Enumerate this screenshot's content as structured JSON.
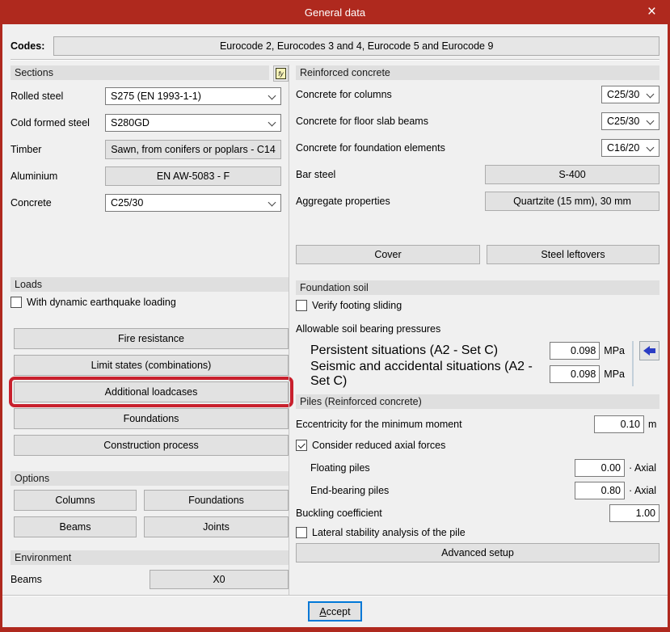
{
  "window": {
    "title": "General data",
    "close_glyph": "×"
  },
  "codes": {
    "label": "Codes:",
    "value": "Eurocode 2, Eurocodes 3 and 4, Eurocode 5 and Eurocode 9"
  },
  "left": {
    "sections": {
      "header": "Sections",
      "fy_icon": "fy",
      "rolled_steel": {
        "label": "Rolled steel",
        "value": "S275 (EN 1993-1-1)"
      },
      "cold_formed_steel": {
        "label": "Cold formed steel",
        "value": "S280GD"
      },
      "timber": {
        "label": "Timber",
        "value": "Sawn, from conifers or poplars - C14"
      },
      "aluminium": {
        "label": "Aluminium",
        "value": "EN AW-5083 - F"
      },
      "concrete": {
        "label": "Concrete",
        "value": "C25/30"
      }
    },
    "loads": {
      "header": "Loads",
      "dynamic_earthquake": {
        "label": "With dynamic earthquake loading",
        "checked": false
      },
      "fire_resistance": "Fire resistance",
      "limit_states": "Limit states (combinations)",
      "additional_loadcases": "Additional loadcases",
      "foundations": "Foundations",
      "construction_process": "Construction process",
      "highlighted_button": "Additional loadcases"
    },
    "options": {
      "header": "Options",
      "columns": "Columns",
      "foundations": "Foundations",
      "beams": "Beams",
      "joints": "Joints"
    },
    "environment": {
      "header": "Environment",
      "beams": {
        "label": "Beams",
        "value": "X0"
      }
    }
  },
  "right": {
    "reinforced_concrete": {
      "header": "Reinforced concrete",
      "concrete_columns": {
        "label": "Concrete for columns",
        "value": "C25/30"
      },
      "concrete_floor_slab_beams": {
        "label": "Concrete for floor slab beams",
        "value": "C25/30"
      },
      "concrete_foundation_elements": {
        "label": "Concrete for foundation elements",
        "value": "C16/20"
      },
      "bar_steel": {
        "label": "Bar steel",
        "value": "S-400"
      },
      "aggregate": {
        "label": "Aggregate properties",
        "value": "Quartzite (15 mm), 30 mm"
      },
      "cover_button": "Cover",
      "steel_leftovers_button": "Steel leftovers"
    },
    "foundation_soil": {
      "header": "Foundation soil",
      "verify_footing_sliding": {
        "label": "Verify footing sliding",
        "checked": false
      },
      "pressures_label": "Allowable soil bearing pressures",
      "persistent": {
        "label": "Persistent situations (A2 - Set C)",
        "value": "0.098",
        "unit": "MPa"
      },
      "seismic": {
        "label": "Seismic and accidental situations (A2 - Set C)",
        "value": "0.098",
        "unit": "MPa"
      }
    },
    "piles": {
      "header": "Piles (Reinforced concrete)",
      "eccentricity": {
        "label": "Eccentricity for the minimum moment",
        "value": "0.10",
        "unit": "m"
      },
      "consider_reduced": {
        "label": "Consider reduced axial forces",
        "checked": true
      },
      "floating": {
        "label": "Floating piles",
        "value": "0.00",
        "unit": "· Axial"
      },
      "end_bearing": {
        "label": "End-bearing piles",
        "value": "0.80",
        "unit": "· Axial"
      },
      "buckling": {
        "label": "Buckling coefficient",
        "value": "1.00"
      },
      "lateral_stability": {
        "label": "Lateral stability analysis of the pile",
        "checked": false
      },
      "advanced_setup_button": "Advanced setup"
    }
  },
  "footer": {
    "accept_mnemonic": "A",
    "accept_rest": "ccept"
  },
  "colors": {
    "titlebar_red": "#AF291E",
    "highlight_red": "#C8202D",
    "focus_blue": "#0078D7",
    "arrow_blue": "#2A3CC4"
  }
}
